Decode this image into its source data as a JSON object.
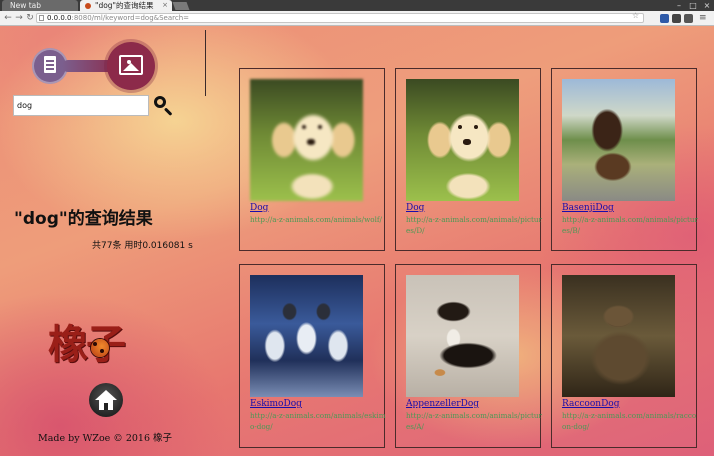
{
  "browser": {
    "tabs": [
      {
        "label": "New tab",
        "active": false
      },
      {
        "label": "\"dog\"的查询结果",
        "active": true
      }
    ],
    "url_host": "0.0.0.0",
    "url_rest": ":8080/ml/keyword=dog&Search="
  },
  "search": {
    "value": "dog"
  },
  "results": {
    "title": "\"dog\"的查询结果",
    "stats": "共77条 用时0.016081 s"
  },
  "brand": {
    "logo_text": "橡子"
  },
  "footer": {
    "text": "Made by WZoe © 2016 橡子"
  },
  "cards": [
    {
      "name": "Dog",
      "url": "http://a-z-animals.com/animals/wolf/",
      "image": "golden-retriever-blurred"
    },
    {
      "name": "Dog",
      "url": "http://a-z-animals.com/animals/pictures/D/",
      "image": "golden-retriever"
    },
    {
      "name": "BasenjiDog",
      "url": "http://a-z-animals.com/animals/pictures/B/",
      "image": "basenji-dog"
    },
    {
      "name": "EskimoDog",
      "url": "http://a-z-animals.com/animals/eskimo-dog/",
      "image": "sled-dogs"
    },
    {
      "name": "AppenzellerDog",
      "url": "http://a-z-animals.com/animals/pictures/A/",
      "image": "appenzeller-dog"
    },
    {
      "name": "RaccoonDog",
      "url": "http://a-z-animals.com/animals/raccoon-dog/",
      "image": "raccoon-dog"
    }
  ],
  "colors": {
    "link": "#1a0dab",
    "url": "#4a9a55",
    "card_border": "#4b2b2b",
    "brand_red": "#9a1f18"
  }
}
